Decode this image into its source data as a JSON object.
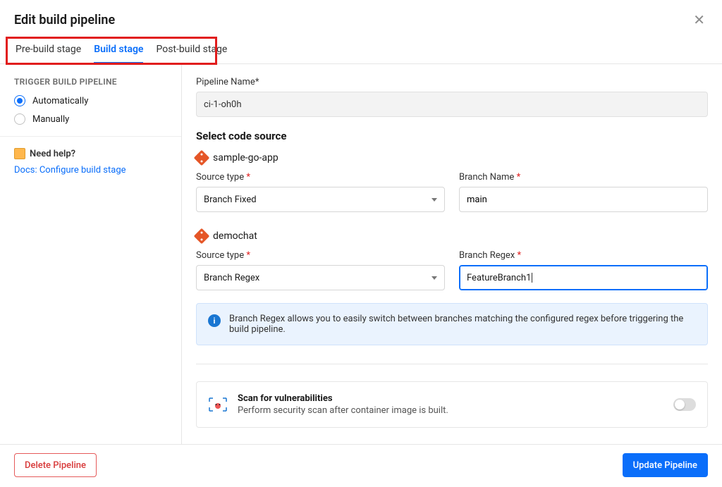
{
  "header": {
    "title": "Edit build pipeline"
  },
  "tabs": [
    {
      "id": "pre",
      "label": "Pre-build stage",
      "active": false
    },
    {
      "id": "build",
      "label": "Build stage",
      "active": true
    },
    {
      "id": "post",
      "label": "Post-build stage",
      "active": false
    }
  ],
  "sidebar": {
    "section_label": "TRIGGER BUILD PIPELINE",
    "options": [
      {
        "label": "Automatically",
        "selected": true
      },
      {
        "label": "Manually",
        "selected": false
      }
    ],
    "help_label": "Need help?",
    "doc_link": "Docs: Configure build stage"
  },
  "form": {
    "pipeline_name_label": "Pipeline Name*",
    "pipeline_name_value": "ci-1-oh0h",
    "select_source_heading": "Select code source",
    "sources": [
      {
        "name": "sample-go-app",
        "source_type_label": "Source type",
        "source_type_value": "Branch Fixed",
        "branch_label": "Branch Name",
        "branch_value": "main",
        "focused": false
      },
      {
        "name": "demochat",
        "source_type_label": "Source type",
        "source_type_value": "Branch Regex",
        "branch_label": "Branch Regex",
        "branch_value": "FeatureBranch1",
        "focused": true
      }
    ],
    "info_text": "Branch Regex allows you to easily switch between branches matching the configured regex before triggering the build pipeline.",
    "scan": {
      "title": "Scan for vulnerabilities",
      "desc": "Perform security scan after container image is built.",
      "enabled": false
    }
  },
  "footer": {
    "delete_label": "Delete Pipeline",
    "update_label": "Update Pipeline"
  },
  "asterisk": " *"
}
